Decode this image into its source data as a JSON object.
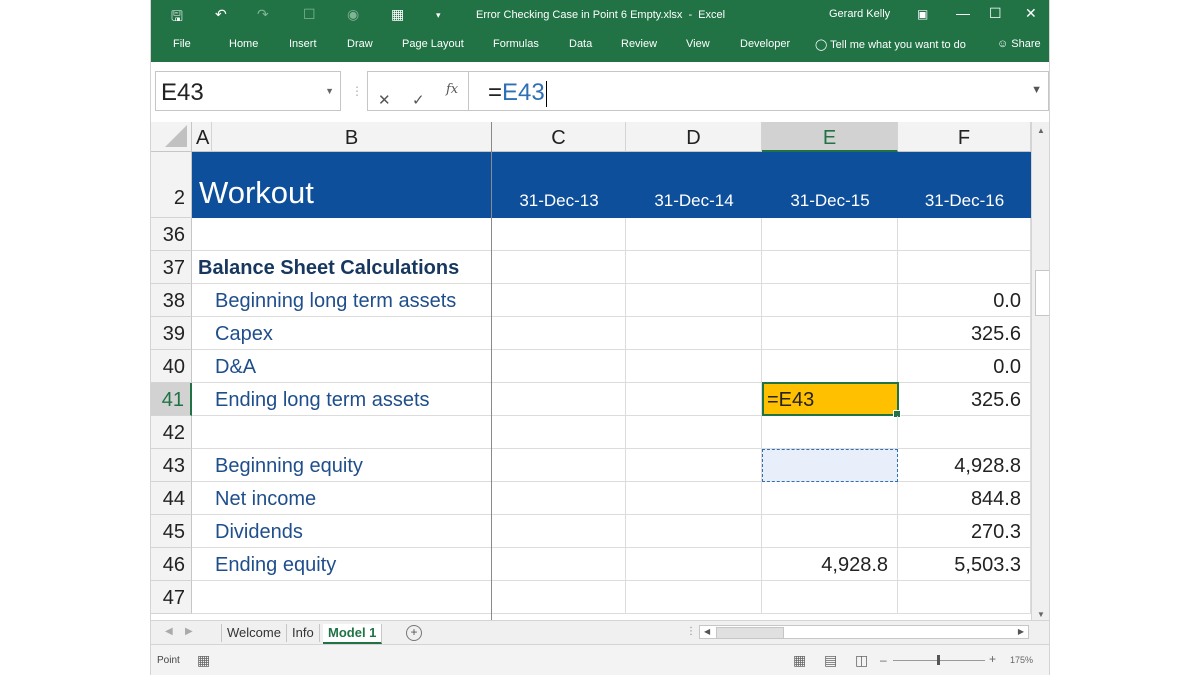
{
  "window": {
    "filename": "Error Checking Case in Point 6 Empty.xlsx",
    "separator": "-",
    "app_name": "Excel",
    "user": "Gerard Kelly"
  },
  "ribbon_tabs": [
    "File",
    "Home",
    "Insert",
    "Draw",
    "Page Layout",
    "Formulas",
    "Data",
    "Review",
    "View",
    "Developer"
  ],
  "tell_me": "Tell me what you want to do",
  "share": "Share",
  "formula_bar": {
    "name_box": "E43",
    "cancel_icon": "✕",
    "enter_icon": "✓",
    "fx_label": "fx",
    "formula_eq": "=",
    "formula_ref": "E43"
  },
  "columns": {
    "corner": "",
    "headers": [
      "A",
      "B",
      "C",
      "D",
      "E",
      "F"
    ],
    "selected": "E"
  },
  "header_row": {
    "row_number": "2",
    "title": "Workout",
    "dates": [
      "31-Dec-13",
      "31-Dec-14",
      "31-Dec-15",
      "31-Dec-16"
    ]
  },
  "rows": [
    {
      "num": "36",
      "label": "",
      "e": "",
      "f": ""
    },
    {
      "num": "37",
      "label": "Balance Sheet Calculations",
      "e": "",
      "f": ""
    },
    {
      "num": "38",
      "label": "Beginning long term assets",
      "e": "",
      "f": "0.0"
    },
    {
      "num": "39",
      "label": "Capex",
      "e": "",
      "f": "325.6"
    },
    {
      "num": "40",
      "label": "D&A",
      "e": "",
      "f": "0.0"
    },
    {
      "num": "41",
      "label": "Ending long term assets",
      "e": "=E43",
      "f": "325.6"
    },
    {
      "num": "42",
      "label": "",
      "e": "",
      "f": ""
    },
    {
      "num": "43",
      "label": "Beginning equity",
      "e": "",
      "f": "4,928.8"
    },
    {
      "num": "44",
      "label": "Net income",
      "e": "",
      "f": "844.8"
    },
    {
      "num": "45",
      "label": "Dividends",
      "e": "",
      "f": "270.3"
    },
    {
      "num": "46",
      "label": "Ending equity",
      "e": "4,928.8",
      "f": "5,503.3"
    },
    {
      "num": "47",
      "label": "",
      "e": "",
      "f": ""
    }
  ],
  "sheet_tabs": [
    "Welcome",
    "Info",
    "Model 1"
  ],
  "active_sheet": "Model 1",
  "status": {
    "mode": "Point",
    "zoom": "175%"
  },
  "colors": {
    "ribbon": "#217346",
    "header_band": "#0e4f9b",
    "active_cell": "#ffc000",
    "label_text": "#1f4e8c"
  }
}
